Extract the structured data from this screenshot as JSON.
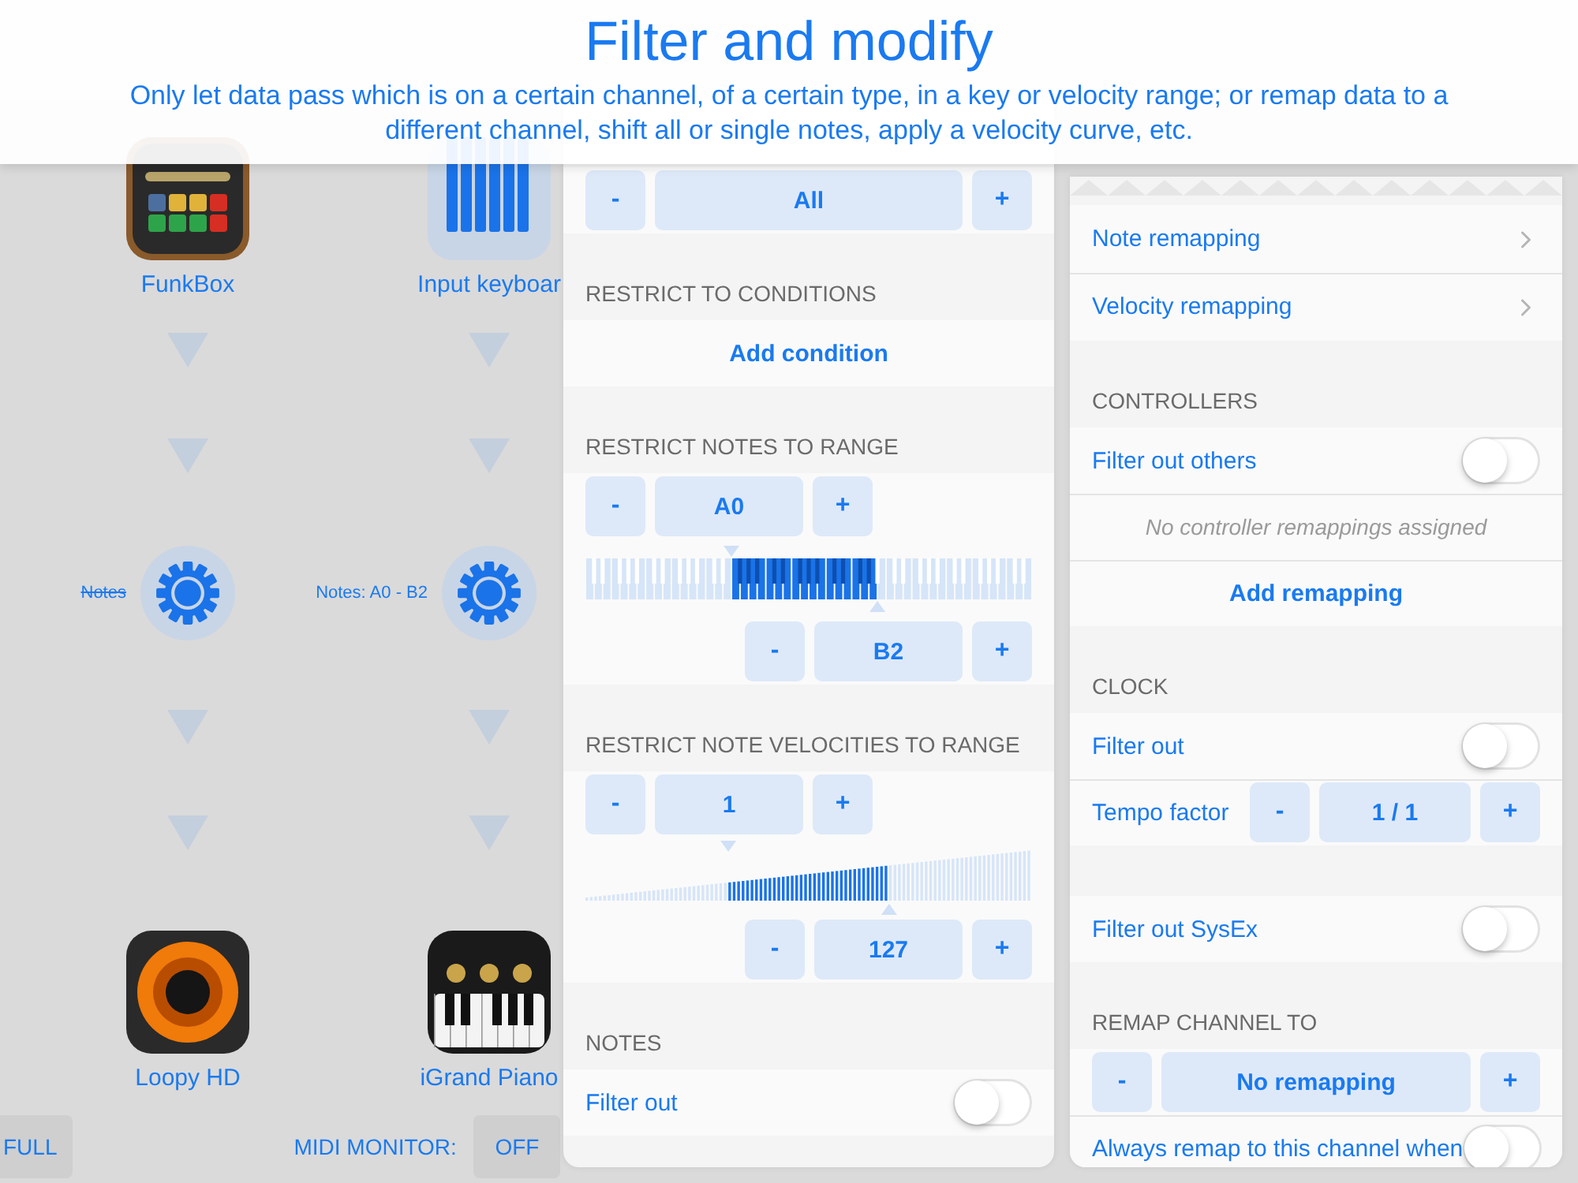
{
  "banner": {
    "title": "Filter and modify",
    "description": "Only let data pass which is on a certain channel, of a certain type, in a key or velocity range; or remap data to a different channel, shift all or single notes, apply a velocity curve, etc."
  },
  "routing": [
    {
      "source": "FunkBox",
      "modifier": {
        "label": "Notes",
        "disabled": true
      },
      "destination": "Loopy HD"
    },
    {
      "source": "Input keyboar",
      "modifier": {
        "label": "Notes: A0 - B2",
        "disabled": false
      },
      "destination": "iGrand Piano"
    }
  ],
  "bottom_bar": {
    "full": "FULL",
    "monitor_label": "MIDI MONITOR:",
    "monitor_value": "OFF"
  },
  "modifier_panel": {
    "sections": [
      {
        "rows": [
          {
            "kind": "wide-stepper",
            "minus": "-",
            "value": "All",
            "plus": "+"
          }
        ]
      },
      {
        "header": "RESTRICT TO CONDITIONS",
        "rows": [
          {
            "kind": "action",
            "label": "Add condition"
          }
        ]
      },
      {
        "header": "RESTRICT NOTES TO RANGE",
        "rows": [
          {
            "kind": "stepper",
            "minus": "-",
            "value": "A0",
            "plus": "+"
          },
          {
            "kind": "keyboard"
          },
          {
            "kind": "end-stepper",
            "minus": "-",
            "value": "B2",
            "plus": "+"
          }
        ]
      },
      {
        "header": "RESTRICT NOTE VELOCITIES TO RANGE",
        "rows": [
          {
            "kind": "stepper",
            "minus": "-",
            "value": "1",
            "plus": "+"
          },
          {
            "kind": "velocity"
          },
          {
            "kind": "end-stepper",
            "minus": "-",
            "value": "127",
            "plus": "+"
          }
        ]
      },
      {
        "header": "NOTES",
        "rows": [
          {
            "kind": "toggle",
            "label": "Filter out",
            "on": false
          }
        ]
      }
    ]
  },
  "remap_panel": {
    "sections": [
      {
        "rows": [
          {
            "kind": "link",
            "label": "Note remapping"
          },
          {
            "kind": "link",
            "label": "Velocity remapping"
          }
        ]
      },
      {
        "header": "CONTROLLERS",
        "rows": [
          {
            "kind": "toggle",
            "label": "Filter out others",
            "on": false
          },
          {
            "kind": "note",
            "label": "No controller remappings assigned"
          },
          {
            "kind": "action",
            "label": "Add remapping"
          }
        ]
      },
      {
        "header": "CLOCK",
        "rows": [
          {
            "kind": "toggle",
            "label": "Filter out",
            "on": false
          },
          {
            "kind": "labeled-stepper",
            "label": "Tempo factor",
            "minus": "-",
            "value": "1 / 1",
            "plus": "+"
          }
        ]
      },
      {
        "rows": [
          {
            "kind": "toggle",
            "label": "Filter out SysEx",
            "on": false
          }
        ]
      },
      {
        "header": "REMAP CHANNEL TO",
        "rows": [
          {
            "kind": "wide-stepper",
            "minus": "-",
            "value": "No remapping",
            "plus": "+"
          },
          {
            "kind": "toggle",
            "label": "Always remap to this channel when",
            "on": false
          }
        ]
      }
    ]
  }
}
